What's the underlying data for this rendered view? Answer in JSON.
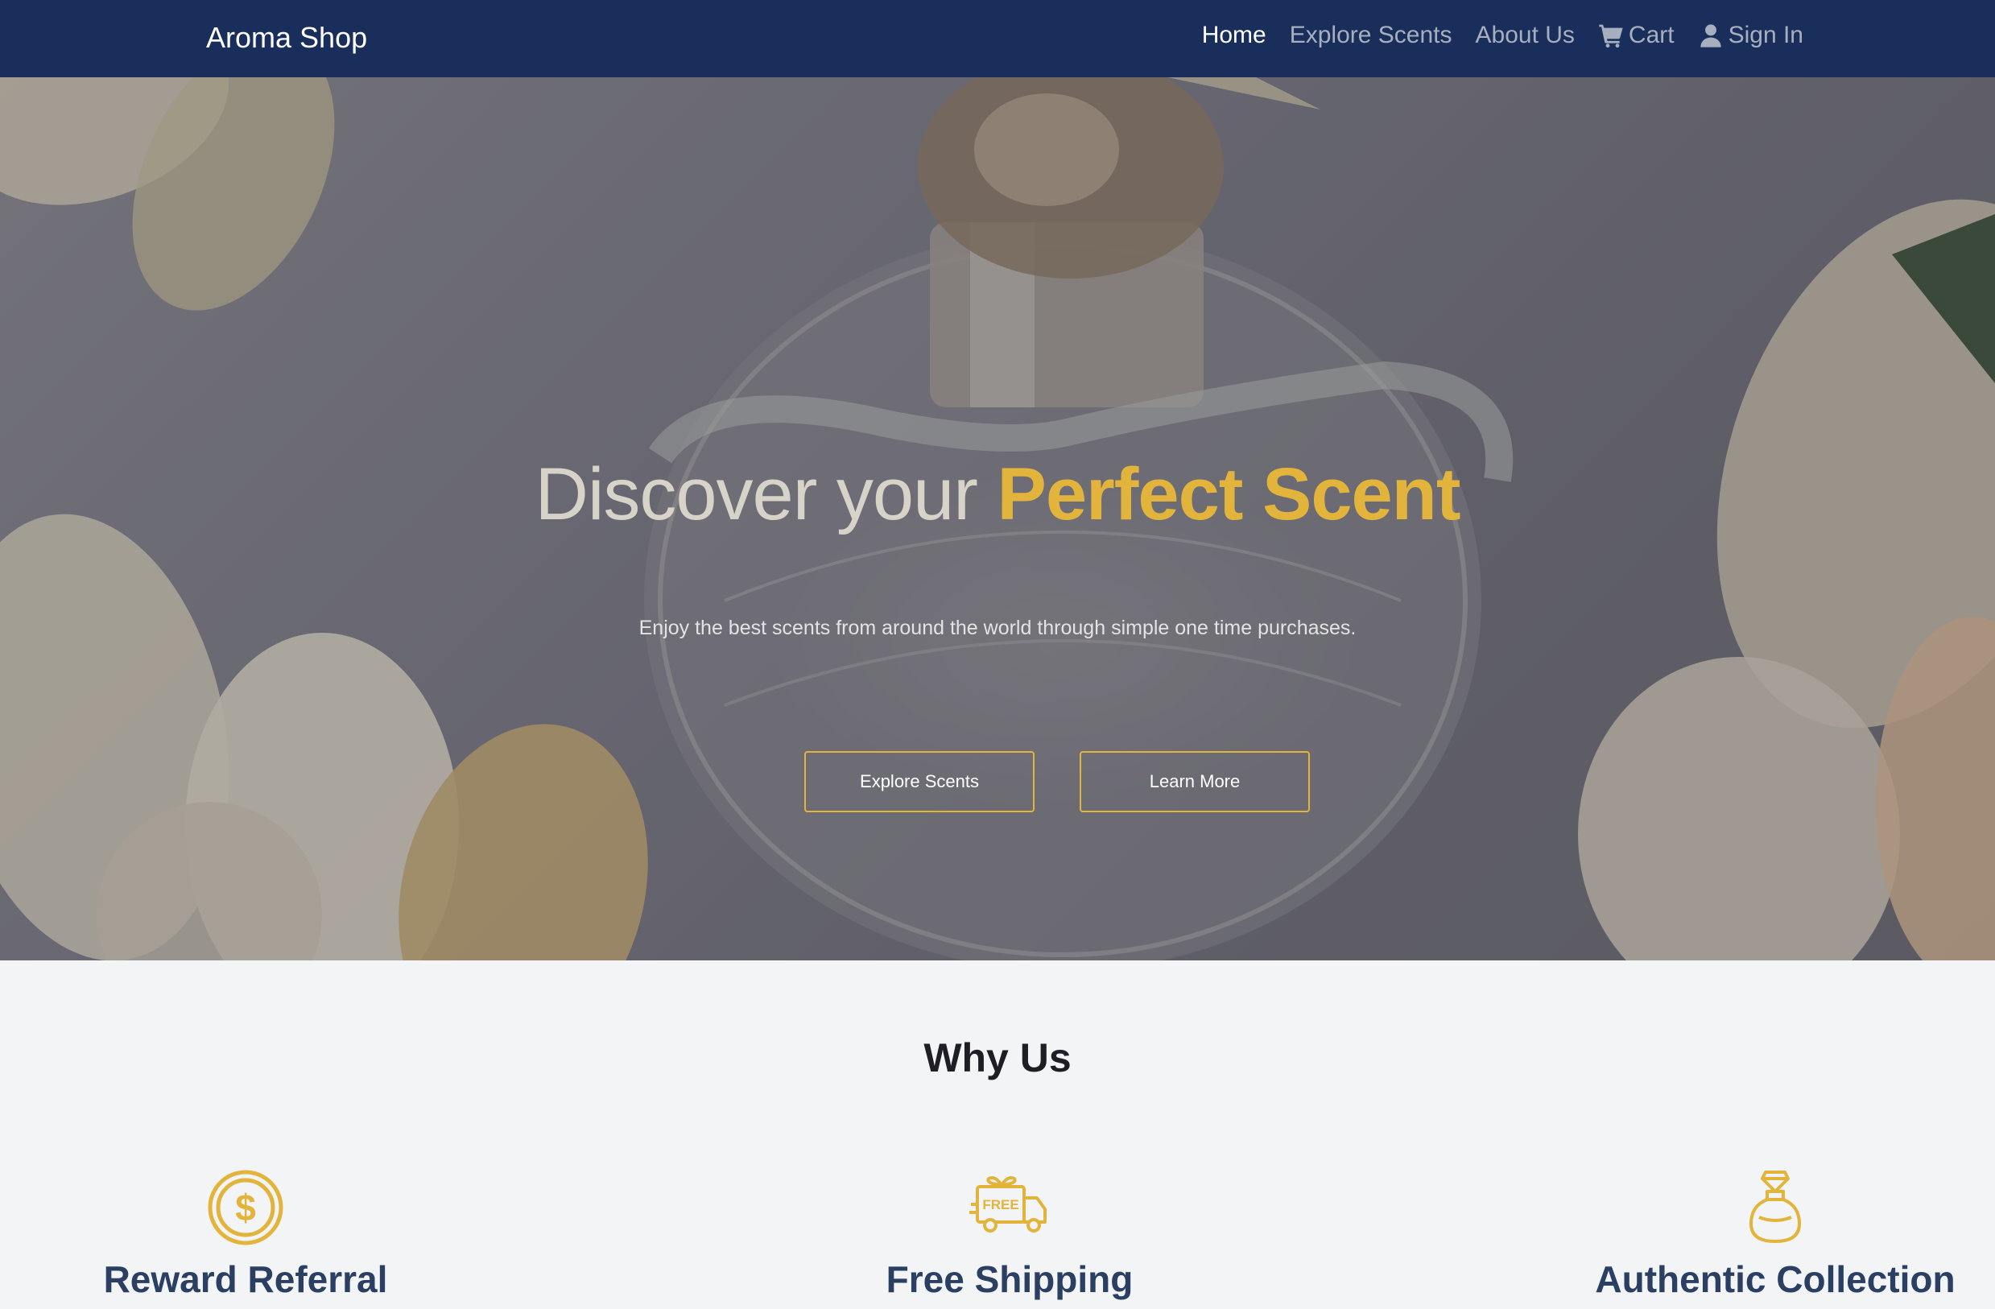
{
  "brand": "Aroma Shop",
  "nav": {
    "home": "Home",
    "explore": "Explore Scents",
    "about": "About Us",
    "cart": "Cart",
    "signin": "Sign In"
  },
  "hero": {
    "title_plain": "Discover your",
    "title_accent": "Perfect Scent",
    "subtitle": "Enjoy the best scents from around the world through simple one time purchases.",
    "btn_explore": "Explore Scents",
    "btn_learn": "Learn More"
  },
  "why": {
    "title": "Why Us",
    "features": [
      {
        "label": "Reward Referral",
        "icon": "dollar-coin-icon"
      },
      {
        "label": "Free Shipping",
        "icon": "free-delivery-truck-icon"
      },
      {
        "label": "Authentic Collection",
        "icon": "perfume-bottle-icon"
      }
    ]
  },
  "colors": {
    "navbar": "#1a2e5c",
    "accent": "#e3b43c",
    "feature_text": "#2b3f63",
    "page_bg": "#f3f4f6"
  }
}
